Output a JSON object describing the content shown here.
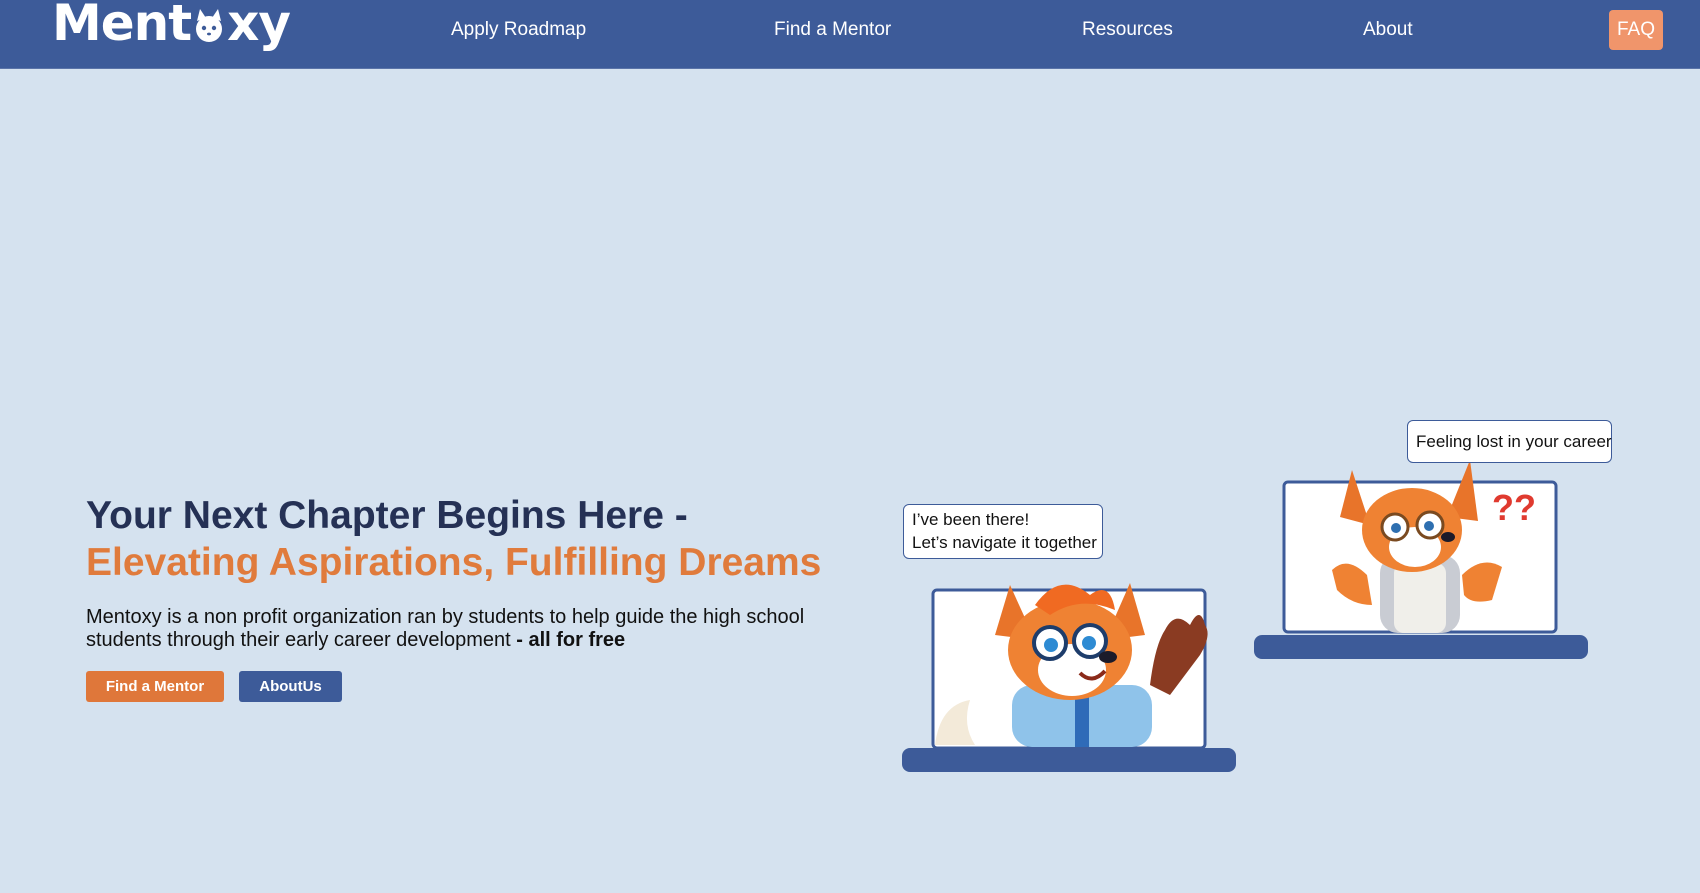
{
  "nav": {
    "logo_text_before": "Ment",
    "logo_text_after": "xy",
    "links": [
      {
        "label": "Apply Roadmap"
      },
      {
        "label": "Find a Mentor"
      },
      {
        "label": "Resources"
      },
      {
        "label": "About"
      }
    ],
    "faq_label": "FAQ"
  },
  "hero": {
    "title_line1": "Your Next Chapter Begins Here -",
    "title_line2": "Elevating Aspirations, Fulfilling Dreams",
    "description": "Mentoxy is a non profit organization ran by students to help guide the high school students through their early career development",
    "description_bold": " - all for free",
    "primary_button": "Find a Mentor",
    "secondary_button": "AboutUs"
  },
  "illustration": {
    "bubble_left_line1": "I’ve been there!",
    "bubble_left_line2": "Let’s navigate it together",
    "bubble_right": "Feeling lost in your career",
    "question_marks": "??"
  },
  "colors": {
    "nav_bg": "#3d5b99",
    "page_bg": "#d5e2ef",
    "accent_orange": "#e07b3c",
    "faq_bg": "#f0956b",
    "title_dark": "#253155"
  }
}
